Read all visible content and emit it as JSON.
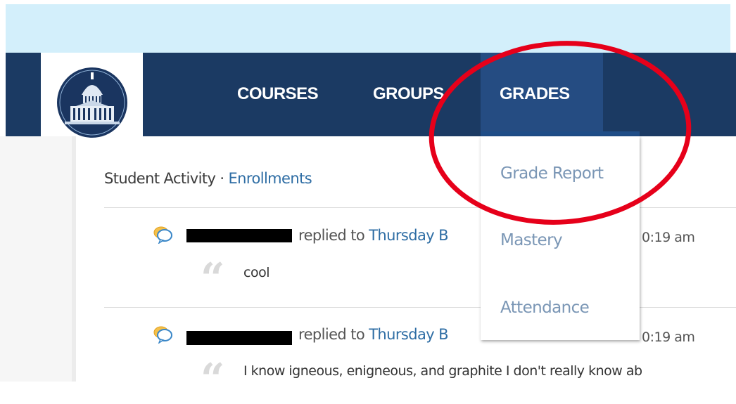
{
  "navbar": {
    "items": [
      {
        "label": "COURSES"
      },
      {
        "label": "GROUPS"
      },
      {
        "label": "GRADES",
        "active": true
      }
    ]
  },
  "grades_dropdown": {
    "items": [
      {
        "label": "Grade Report"
      },
      {
        "label": "Mastery"
      },
      {
        "label": "Attendance"
      }
    ]
  },
  "activity": {
    "title": "Student Activity",
    "separator": "·",
    "link": "Enrollments",
    "entries": [
      {
        "action": "replied to",
        "target": "Thursday B",
        "time": "0:19 am",
        "comment": "cool"
      },
      {
        "action": "replied to",
        "target": "Thursday B",
        "time": "0:19 am",
        "comment": "I know igneous, enigneous, and graphite I don't really know ab"
      }
    ]
  },
  "colors": {
    "navbar": "#1b3a63",
    "nav_active": "#254c82",
    "top_band": "#d3effb",
    "link": "#2e6da4",
    "dropdown_text": "#7a96b5",
    "annotation": "#e6001a"
  },
  "icons": {
    "logo": "capitol-dome-logo",
    "reply": "chat-bubbles-icon",
    "quote": "quote-icon"
  }
}
